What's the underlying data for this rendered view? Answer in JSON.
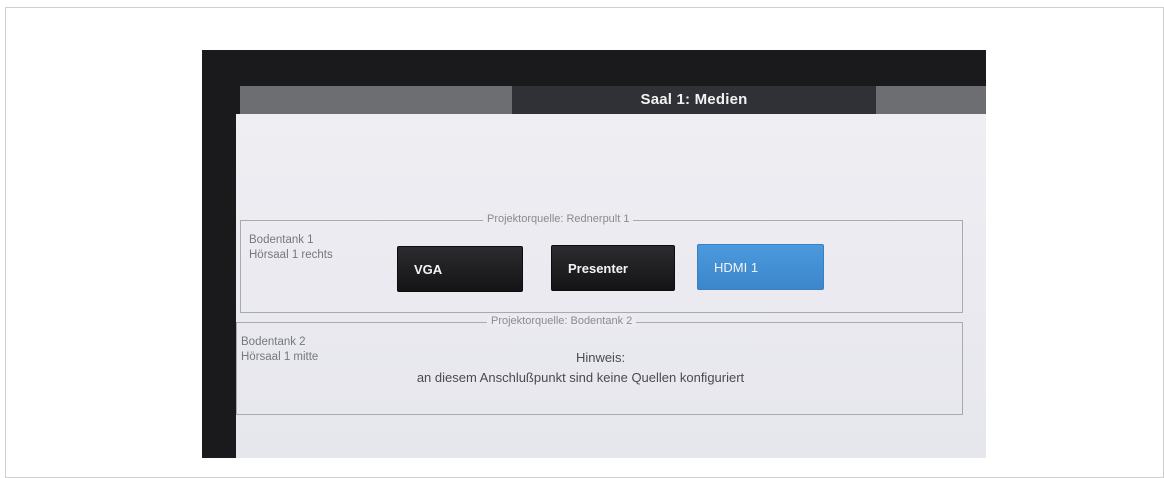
{
  "header": {
    "title": "Saal 1: Medien"
  },
  "groups": [
    {
      "legend": "Projektorquelle: Rednerpult 1",
      "location_line1": "Bodentank 1",
      "location_line2": "Hörsaal 1 rechts",
      "buttons": [
        {
          "label": "VGA",
          "state": "inactive"
        },
        {
          "label": "Presenter",
          "state": "inactive"
        },
        {
          "label": "HDMI 1",
          "state": "active"
        }
      ]
    },
    {
      "legend": "Projektorquelle: Bodentank 2",
      "location_line1": "Bodentank 2",
      "location_line2": "Hörsaal 1 mitte",
      "hint_title": "Hinweis:",
      "hint_text": "an diesem Anschlußpunkt sind keine Quellen konfiguriert"
    }
  ],
  "colors": {
    "active_button": "#4a95da",
    "inactive_button": "#1e1e21",
    "title_bar": "#2f3136"
  }
}
